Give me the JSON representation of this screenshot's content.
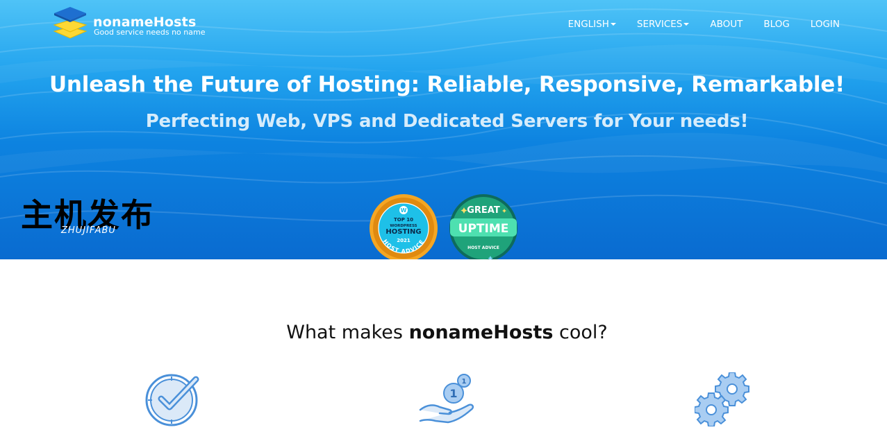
{
  "brand": {
    "name": "nonameHosts",
    "tagline": "Good service needs no name"
  },
  "nav": {
    "items": [
      {
        "label": "ENGLISH",
        "has_dropdown": true
      },
      {
        "label": "SERVICES",
        "has_dropdown": true
      },
      {
        "label": "ABOUT",
        "has_dropdown": false
      },
      {
        "label": "BLOG",
        "has_dropdown": false
      },
      {
        "label": "LOGIN",
        "has_dropdown": false
      }
    ]
  },
  "hero": {
    "headline": "Unleash the Future of Hosting: Reliable, Responsive, Remarkable!",
    "subheadline": "Perfecting Web, VPS and Dedicated Servers for Your needs!"
  },
  "watermark": {
    "chinese": "主机发布",
    "pinyin": "ZHUJIFABU"
  },
  "badges": [
    {
      "icon": "wordpress-icon",
      "line1": "TOP 10",
      "line2": "WORDPRESS",
      "line3": "HOSTING",
      "year": "2021",
      "ring_text": "HOST ADVICE"
    },
    {
      "top": "GREAT",
      "main": "UPTIME",
      "bottom": "HOST ADVICE"
    }
  ],
  "features": {
    "title_pre": "What makes ",
    "title_brand": "nonameHosts",
    "title_post": " cool?",
    "icons": [
      "clock-check-icon",
      "hand-coin-icon",
      "gears-icon"
    ],
    "coin_badge": "1"
  },
  "colors": {
    "hero_top": "#4fc3f7",
    "hero_bottom": "#0a6bd0",
    "logo_blue": "#1565c0",
    "logo_yellow": "#fdd835",
    "badge_orange": "#f5a623",
    "badge_green": "#1fa37a",
    "feature_icon": "#4a90d9"
  }
}
